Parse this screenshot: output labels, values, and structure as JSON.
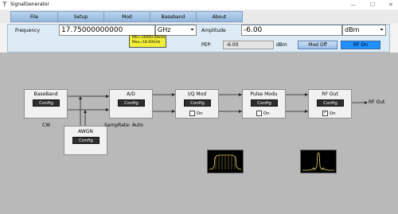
{
  "window": {
    "title": "SignalGenerator",
    "minimize_glyph": "—",
    "maximize_glyph": "☐",
    "close_glyph": "✕"
  },
  "menu": [
    "File",
    "Setup",
    "Mod",
    "Baseband",
    "About"
  ],
  "params": {
    "frequency_label": "Frequency",
    "frequency_value": "17.75000000000",
    "frequency_unit": "GHz",
    "amplitude_label": "Amplitude",
    "amplitude_value": "-6.00",
    "amplitude_unit": "dBm",
    "tooltip_min": "Min=10000.00kHz",
    "tooltip_max": "Max=18.00GHz",
    "pep_label": "PEP:",
    "pep_value": "-6.00",
    "pep_unit": "dBm",
    "mod_button": "Mod Off",
    "rf_button": "RF On",
    "dropdown_arrow": "⏷"
  },
  "blocks": {
    "baseband": {
      "title": "BaseBand",
      "config": "Config"
    },
    "ad": {
      "title": "A/D",
      "config": "Config"
    },
    "iq": {
      "title": "I/Q Mod",
      "config": "Config",
      "check_label": "On",
      "checked": false
    },
    "pulse": {
      "title": "Pulse Modu",
      "config": "Config",
      "check_label": "On",
      "checked": false
    },
    "rf": {
      "title": "RF Out",
      "config": "Config",
      "check_label": "On",
      "checked": true
    },
    "awgn": {
      "title": "AWGN",
      "config": "Config"
    }
  },
  "labels": {
    "cw": "CW",
    "samp_rate": "SampRate: Auto",
    "rf_out": "RF Out"
  },
  "colors": {
    "accent_blue": "#1e90ff",
    "scope_trace": "#e8d36a"
  }
}
